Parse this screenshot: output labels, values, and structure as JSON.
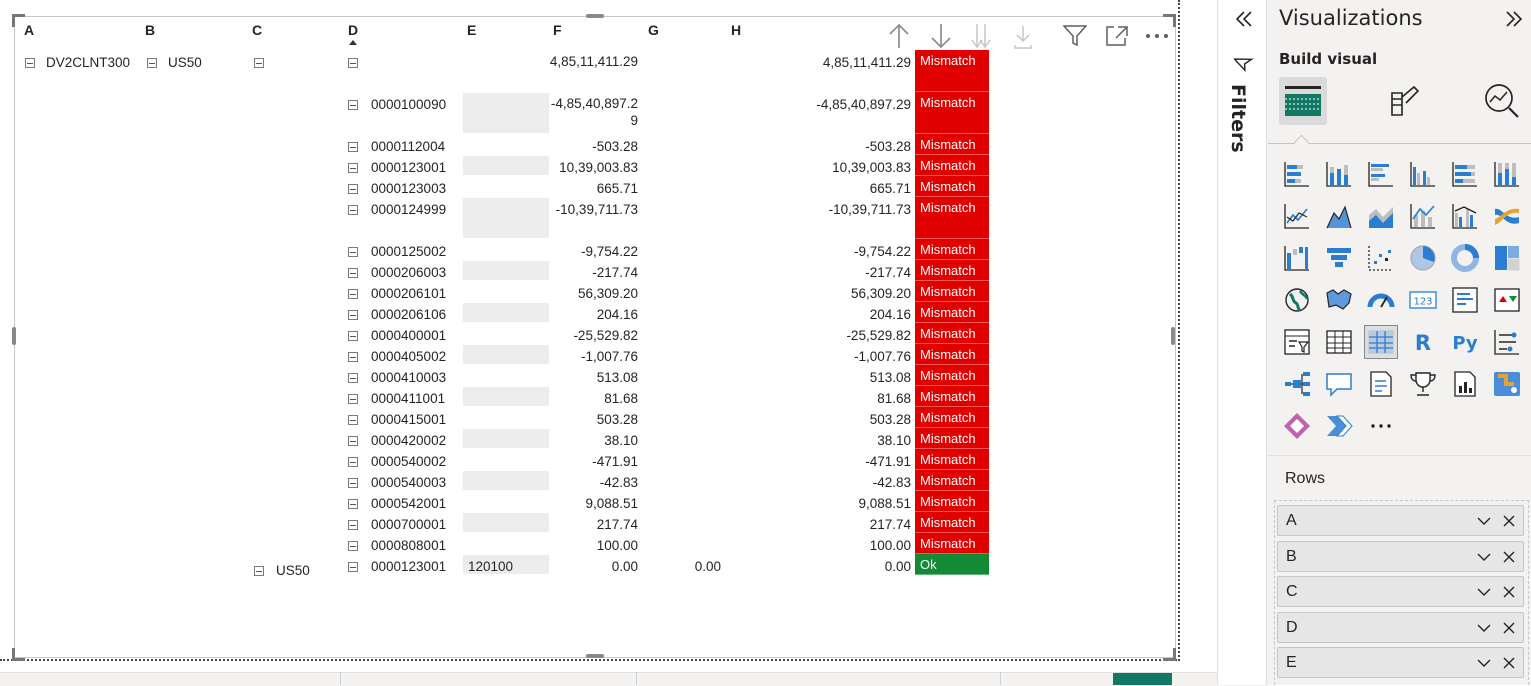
{
  "matrix": {
    "columns": [
      "A",
      "B",
      "C",
      "D",
      "E",
      "F",
      "G",
      "H"
    ],
    "group_a": "DV2CLNT300",
    "group_b": "US50",
    "group_c2": "US50",
    "rows": [
      {
        "d": "",
        "e": "",
        "f": "4,85,11,411.29",
        "g": "",
        "h": "4,85,11,411.29",
        "status": "Mismatch"
      },
      {
        "d": "0000100090",
        "e": "",
        "f": "-4,85,40,897.29",
        "g": "",
        "h": "-4,85,40,897.29",
        "status": "Mismatch"
      },
      {
        "d": "0000112004",
        "e": "",
        "f": "-503.28",
        "g": "",
        "h": "-503.28",
        "status": "Mismatch"
      },
      {
        "d": "0000123001",
        "e": "",
        "f": "10,39,003.83",
        "g": "",
        "h": "10,39,003.83",
        "status": "Mismatch"
      },
      {
        "d": "0000123003",
        "e": "",
        "f": "665.71",
        "g": "",
        "h": "665.71",
        "status": "Mismatch"
      },
      {
        "d": "0000124999",
        "e": "",
        "f": "-10,39,711.73",
        "g": "",
        "h": "-10,39,711.73",
        "status": "Mismatch"
      },
      {
        "d": "0000125002",
        "e": "",
        "f": "-9,754.22",
        "g": "",
        "h": "-9,754.22",
        "status": "Mismatch"
      },
      {
        "d": "0000206003",
        "e": "",
        "f": "-217.74",
        "g": "",
        "h": "-217.74",
        "status": "Mismatch"
      },
      {
        "d": "0000206101",
        "e": "",
        "f": "56,309.20",
        "g": "",
        "h": "56,309.20",
        "status": "Mismatch"
      },
      {
        "d": "0000206106",
        "e": "",
        "f": "204.16",
        "g": "",
        "h": "204.16",
        "status": "Mismatch"
      },
      {
        "d": "0000400001",
        "e": "",
        "f": "-25,529.82",
        "g": "",
        "h": "-25,529.82",
        "status": "Mismatch"
      },
      {
        "d": "0000405002",
        "e": "",
        "f": "-1,007.76",
        "g": "",
        "h": "-1,007.76",
        "status": "Mismatch"
      },
      {
        "d": "0000410003",
        "e": "",
        "f": "513.08",
        "g": "",
        "h": "513.08",
        "status": "Mismatch"
      },
      {
        "d": "0000411001",
        "e": "",
        "f": "81.68",
        "g": "",
        "h": "81.68",
        "status": "Mismatch"
      },
      {
        "d": "0000415001",
        "e": "",
        "f": "503.28",
        "g": "",
        "h": "503.28",
        "status": "Mismatch"
      },
      {
        "d": "0000420002",
        "e": "",
        "f": "38.10",
        "g": "",
        "h": "38.10",
        "status": "Mismatch"
      },
      {
        "d": "0000540002",
        "e": "",
        "f": "-471.91",
        "g": "",
        "h": "-471.91",
        "status": "Mismatch"
      },
      {
        "d": "0000540003",
        "e": "",
        "f": "-42.83",
        "g": "",
        "h": "-42.83",
        "status": "Mismatch"
      },
      {
        "d": "0000542001",
        "e": "",
        "f": "9,088.51",
        "g": "",
        "h": "9,088.51",
        "status": "Mismatch"
      },
      {
        "d": "0000700001",
        "e": "",
        "f": "217.74",
        "g": "",
        "h": "217.74",
        "status": "Mismatch"
      },
      {
        "d": "0000808001",
        "e": "",
        "f": "100.00",
        "g": "",
        "h": "100.00",
        "status": "Mismatch"
      },
      {
        "d": "0000123001",
        "e": "120100",
        "f": "0.00",
        "g": "0.00",
        "h": "0.00",
        "status": "Ok"
      }
    ],
    "colors": {
      "mismatch": "#e00000",
      "ok": "#138a36"
    }
  },
  "visual_header": {
    "icons": [
      "arrow-up-icon",
      "arrow-down-icon",
      "double-arrow-down-icon",
      "expand-hierarchy-icon",
      "filter-icon",
      "focus-mode-icon",
      "more-options-icon"
    ]
  },
  "filters_pane": {
    "label": "Filters"
  },
  "visualizations_pane": {
    "title": "Visualizations",
    "build_visual_label": "Build visual",
    "fields_well_label": "Rows",
    "fields": [
      "A",
      "B",
      "C",
      "D",
      "E"
    ]
  }
}
